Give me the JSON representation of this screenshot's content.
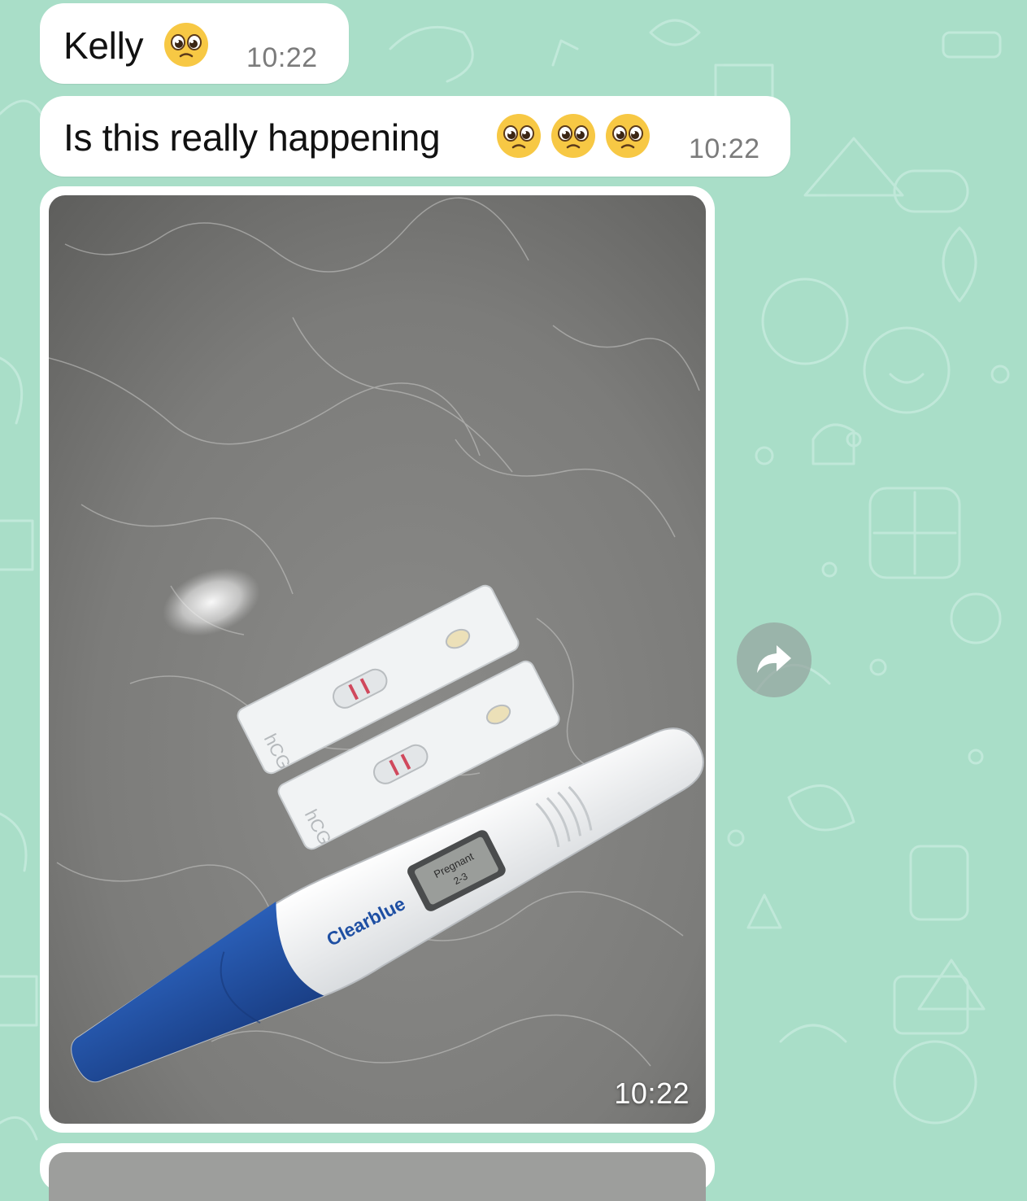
{
  "messages": [
    {
      "text": "Kelly",
      "emoji_count": 1,
      "time": "10:22"
    },
    {
      "text": "Is this really happening",
      "emoji_count": 3,
      "time": "10:22"
    }
  ],
  "photo_message": {
    "time": "10:22",
    "photo_labels": {
      "brand": "Clearblue",
      "display_line1": "Pregnant",
      "display_line2": "2-3",
      "strip_label": "hCG"
    }
  },
  "icons": {
    "emoji": "pleading-face-icon",
    "forward": "forward-arrow-icon"
  },
  "colors": {
    "wallpaper": "#a9dec8",
    "bubble": "#ffffff",
    "time_text": "#7b7b7b",
    "test_blue": "#1e4fa3"
  }
}
